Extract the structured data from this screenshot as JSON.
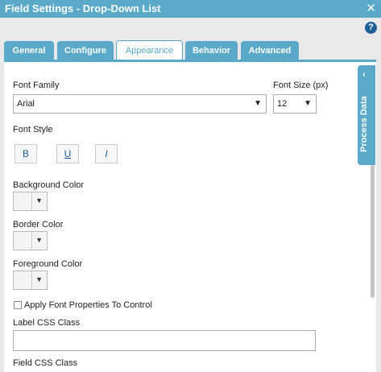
{
  "window": {
    "title": "Field Settings - Drop-Down List",
    "close_glyph": "✕",
    "help_glyph": "?"
  },
  "tabs": [
    {
      "label": "General",
      "active": false
    },
    {
      "label": "Configure",
      "active": false
    },
    {
      "label": "Appearance",
      "active": true
    },
    {
      "label": "Behavior",
      "active": false
    },
    {
      "label": "Advanced",
      "active": false
    }
  ],
  "appearance": {
    "font_family_label": "Font Family",
    "font_family_value": "Arial",
    "font_size_label": "Font Size (px)",
    "font_size_value": "12",
    "font_style_label": "Font Style",
    "bold_label": "B",
    "underline_label": "U",
    "italic_label": "I",
    "background_color_label": "Background Color",
    "border_color_label": "Border Color",
    "foreground_color_label": "Foreground Color",
    "apply_font_label": "Apply Font Properties To Control",
    "apply_font_checked": false,
    "label_css_label": "Label CSS Class",
    "label_css_value": "",
    "field_css_label": "Field CSS Class"
  },
  "side_panel": {
    "label": "Process Data",
    "chevron": "‹"
  },
  "dropdown_caret": "▼",
  "colors": {
    "accent": "#5aa9c8",
    "help": "#1f5f99"
  }
}
